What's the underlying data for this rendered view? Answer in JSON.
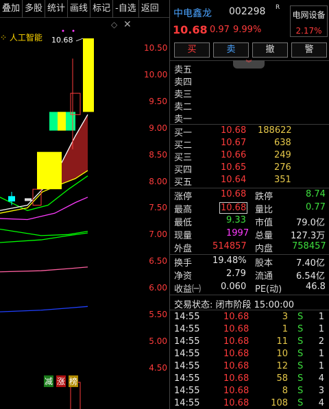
{
  "toolbar": {
    "items": [
      "叠加",
      "多股",
      "统计",
      "画线",
      "标记",
      "-自选",
      "返回"
    ]
  },
  "chart": {
    "indicator_label": "人工智能",
    "high_marker": "10.68",
    "price_axis": [
      "10.50",
      "10.00",
      "9.50",
      "9.00",
      "8.50",
      "8.00",
      "7.50",
      "7.00",
      "6.50",
      "6.00",
      "5.50",
      "5.00",
      "4.50"
    ],
    "badges": [
      "减",
      "涨",
      "榜"
    ],
    "colors": {
      "up": "#ff3b3b",
      "bull_body": "#ffff00",
      "doji": "#00ff88",
      "ma5": "#ffffff",
      "ma10": "#ffff00",
      "ma20": "#ff3bff",
      "ma30": "#00ff00",
      "ma60": "#ff5fa0",
      "ma120": "#2040ff"
    }
  },
  "quote": {
    "name": "中电鑫龙",
    "code": "002298",
    "rz": "R",
    "sector_name": "电网设备",
    "sector_pct": "2.17%",
    "price": "10.68",
    "change": "0.97",
    "change_pct": "9.99%"
  },
  "actions": {
    "buy": "买",
    "sell": "卖",
    "cancel": "撤",
    "alert": "警"
  },
  "order_book": {
    "asks": [
      {
        "label": "卖五"
      },
      {
        "label": "卖四"
      },
      {
        "label": "卖三"
      },
      {
        "label": "卖二"
      },
      {
        "label": "卖一"
      }
    ],
    "bids": [
      {
        "label": "买一",
        "price": "10.68",
        "vol": "188622"
      },
      {
        "label": "买二",
        "price": "10.67",
        "vol": "638"
      },
      {
        "label": "买三",
        "price": "10.66",
        "vol": "249"
      },
      {
        "label": "买四",
        "price": "10.65",
        "vol": "276"
      },
      {
        "label": "买五",
        "price": "10.64",
        "vol": "351"
      }
    ]
  },
  "stats": {
    "zhangting_label": "涨停",
    "zhangting": "10.68",
    "dieting_label": "跌停",
    "dieting": "8.74",
    "high_label": "最高",
    "high": "10.68",
    "liangbi_label": "量比",
    "liangbi": "0.77",
    "low_label": "最低",
    "low": "9.33",
    "shizhi_label": "市值",
    "shizhi": "79.0亿",
    "xianliang_label": "现量",
    "xianliang": "1997",
    "zongliang_label": "总量",
    "zongliang": "127.3万",
    "waipan_label": "外盘",
    "waipan": "514857",
    "neipan_label": "内盘",
    "neipan": "758457",
    "huanshou_label": "换手",
    "huanshou": "19.48%",
    "guben_label": "股本",
    "guben": "7.40亿",
    "jingzi_label": "净资",
    "jingzi": "2.79",
    "liutong_label": "流通",
    "liutong": "6.54亿",
    "shouyi_label": "收益㈠",
    "shouyi": "0.060",
    "pe_label": "PE(动)",
    "pe": "46.8"
  },
  "trade_status": "交易状态: 闭市阶段 15:00:00",
  "ticks": [
    {
      "time": "14:55",
      "price": "10.68",
      "vol": "3",
      "side": "S",
      "count": "1"
    },
    {
      "time": "14:55",
      "price": "10.68",
      "vol": "1",
      "side": "S",
      "count": "1"
    },
    {
      "time": "14:55",
      "price": "10.68",
      "vol": "11",
      "side": "S",
      "count": "2"
    },
    {
      "time": "14:55",
      "price": "10.68",
      "vol": "10",
      "side": "S",
      "count": "1"
    },
    {
      "time": "14:55",
      "price": "10.68",
      "vol": "12",
      "side": "S",
      "count": "1"
    },
    {
      "time": "14:55",
      "price": "10.68",
      "vol": "58",
      "side": "S",
      "count": "4"
    },
    {
      "time": "14:55",
      "price": "10.68",
      "vol": "8",
      "side": "S",
      "count": "3"
    },
    {
      "time": "14:55",
      "price": "10.68",
      "vol": "108",
      "side": "S",
      "count": "4"
    }
  ]
}
